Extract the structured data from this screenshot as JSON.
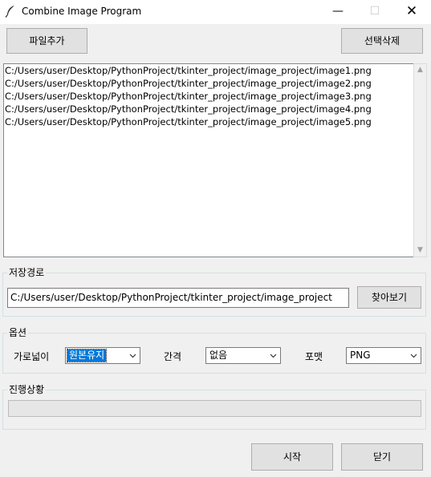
{
  "window": {
    "title": "Combine Image Program",
    "icon": "feather-icon",
    "controls": {
      "minimize": "—",
      "maximize": "☐",
      "close": "✕"
    }
  },
  "toolbar": {
    "add_file_label": "파일추가",
    "delete_selected_label": "선택삭제"
  },
  "file_list": {
    "items": [
      "C:/Users/user/Desktop/PythonProject/tkinter_project/image_project/image1.png",
      "C:/Users/user/Desktop/PythonProject/tkinter_project/image_project/image2.png",
      "C:/Users/user/Desktop/PythonProject/tkinter_project/image_project/image3.png",
      "C:/Users/user/Desktop/PythonProject/tkinter_project/image_project/image4.png",
      "C:/Users/user/Desktop/PythonProject/tkinter_project/image_project/image5.png"
    ]
  },
  "save_path": {
    "legend": "저장경로",
    "value": "C:/Users/user/Desktop/PythonProject/tkinter_project/image_project",
    "browse_label": "찾아보기"
  },
  "options": {
    "legend": "옵션",
    "width_label": "가로넓이",
    "width_value": "원본유지",
    "spacing_label": "간격",
    "spacing_value": "없음",
    "format_label": "포맷",
    "format_value": "PNG"
  },
  "progress": {
    "legend": "진행상황",
    "value": 0
  },
  "actions": {
    "start_label": "시작",
    "close_label": "닫기"
  },
  "colors": {
    "selection": "#0078d7",
    "background": "#f0f0f0"
  }
}
